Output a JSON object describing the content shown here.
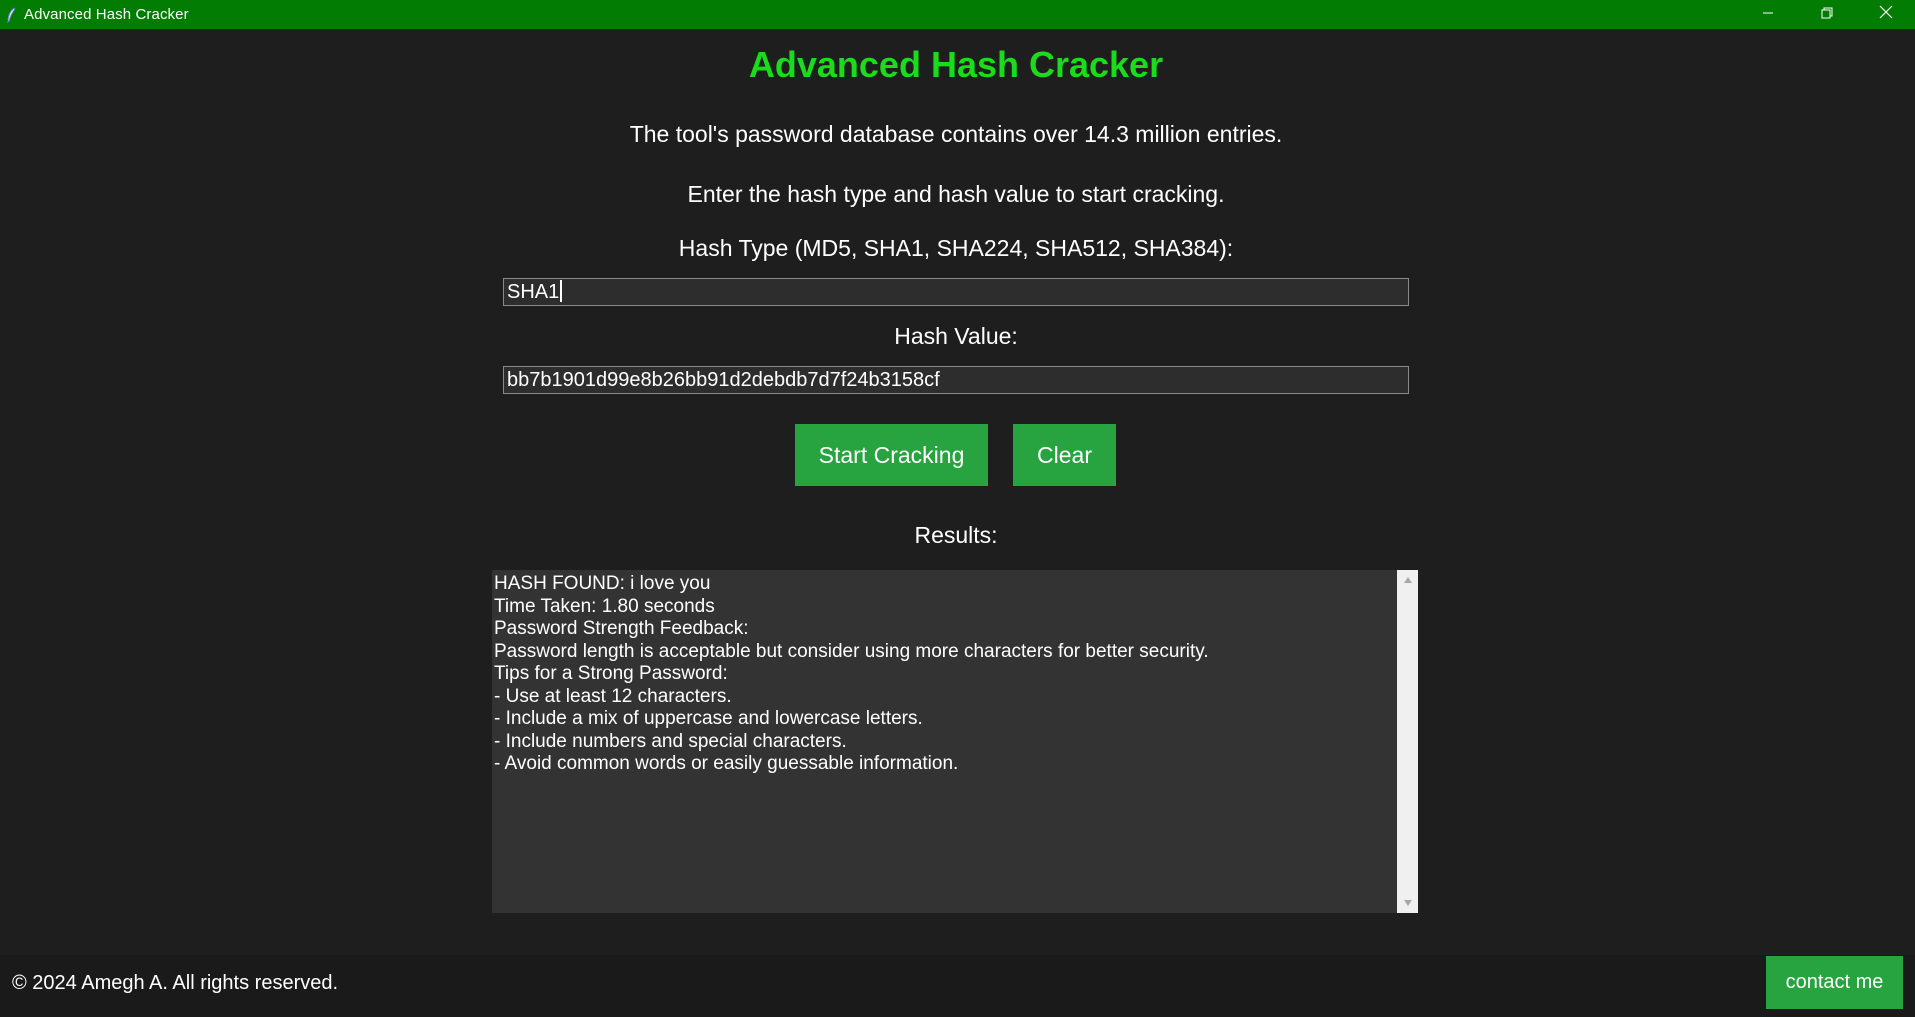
{
  "window": {
    "title": "Advanced Hash Cracker",
    "app_icon": "feather-icon",
    "controls": [
      "minimize-icon",
      "restore-icon",
      "close-icon"
    ],
    "title_bar_color": "#037c03"
  },
  "header": {
    "title": "Advanced Hash Cracker",
    "title_color": "#1bdc1b"
  },
  "info": {
    "database_note": "The tool's password database contains over 14.3 million entries.",
    "instruction": "Enter the hash type and hash value to start cracking."
  },
  "form": {
    "hash_type_label": "Hash Type (MD5, SHA1, SHA224, SHA512, SHA384):",
    "hash_type_value": "SHA1",
    "hash_value_label": "Hash Value:",
    "hash_value_value": "bb7b1901d99e8b26bb91d2debdb7d7f24b3158cf"
  },
  "actions": {
    "start_label": "Start Cracking",
    "clear_label": "Clear",
    "button_color": "#27a43f"
  },
  "results": {
    "label": "Results:",
    "lines": [
      "HASH FOUND: i love you",
      "Time Taken: 1.80 seconds",
      "Password Strength Feedback:",
      "Password length is acceptable but consider using more characters for better security.",
      "Tips for a Strong Password:",
      "- Use at least 12 characters.",
      "- Include a mix of uppercase and lowercase letters.",
      "- Include numbers and special characters.",
      "- Avoid common words or easily guessable information."
    ]
  },
  "footer": {
    "copyright": "© 2024 Amegh A. All rights reserved.",
    "contact_label": "contact me"
  }
}
